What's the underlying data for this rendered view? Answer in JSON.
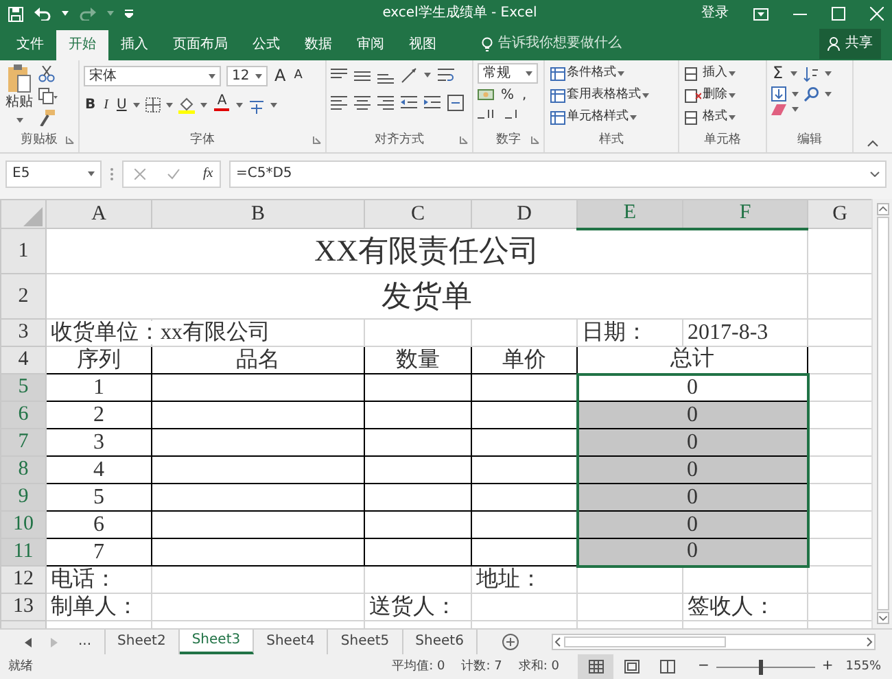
{
  "window": {
    "title": "excel学生成绩单 - Excel",
    "sign_in": "登录"
  },
  "ribbon_tabs": [
    {
      "label": "文件",
      "selected": false
    },
    {
      "label": "开始",
      "selected": true
    },
    {
      "label": "插入",
      "selected": false
    },
    {
      "label": "页面布局",
      "selected": false
    },
    {
      "label": "公式",
      "selected": false
    },
    {
      "label": "数据",
      "selected": false
    },
    {
      "label": "审阅",
      "selected": false
    },
    {
      "label": "视图",
      "selected": false
    }
  ],
  "tell_me": {
    "placeholder": "告诉我你想要做什么"
  },
  "share": "共享",
  "ribbon": {
    "clipboard": {
      "paste": "粘贴",
      "label": "剪贴板"
    },
    "font": {
      "name": "宋体",
      "size": "12",
      "grow": "A",
      "shrink": "A",
      "bold": "B",
      "italic": "I",
      "underline": "U",
      "font_color": "A",
      "label": "字体"
    },
    "alignment": {
      "label": "对齐方式"
    },
    "number": {
      "format": "常规",
      "percent": "%",
      "comma": ",",
      "label": "数字"
    },
    "styles": {
      "items": [
        "条件格式",
        "套用表格格式",
        "单元格样式"
      ],
      "label": "样式"
    },
    "cells": {
      "items": [
        "插入",
        "删除",
        "格式"
      ],
      "label": "单元格"
    },
    "editing": {
      "sum": "Σ",
      "label": "编辑"
    }
  },
  "formula_bar": {
    "name_box": "E5",
    "function_label": "fx",
    "formula": "=C5*D5"
  },
  "columns": [
    {
      "label": "A",
      "selected": false
    },
    {
      "label": "B",
      "selected": false
    },
    {
      "label": "C",
      "selected": false
    },
    {
      "label": "D",
      "selected": false
    },
    {
      "label": "E",
      "selected": true
    },
    {
      "label": "F",
      "selected": true
    },
    {
      "label": "G",
      "selected": false
    }
  ],
  "rows": [
    {
      "number": "1",
      "selected": false,
      "kind": "title",
      "text": "XX有限责任公司"
    },
    {
      "number": "2",
      "selected": false,
      "kind": "title",
      "text": "发货单"
    },
    {
      "number": "3",
      "selected": false,
      "kind": "info",
      "cells": [
        {
          "text": "收货单位：xx有限公司"
        },
        {},
        {},
        {},
        {
          "text": "日期："
        },
        {
          "text": "2017-8-3"
        },
        {}
      ]
    },
    {
      "number": "4",
      "selected": false,
      "kind": "table",
      "cells": [
        {
          "text": "序列",
          "selected": false
        },
        {
          "text": "品名",
          "selected": false
        },
        {
          "text": "数量",
          "selected": false
        },
        {
          "text": "单价",
          "selected": false
        },
        {
          "text": "总计",
          "selected": false
        }
      ]
    },
    {
      "number": "5",
      "selected": true,
      "kind": "table",
      "cells": [
        {
          "text": "1",
          "selected": false
        },
        {
          "selected": false
        },
        {
          "selected": false
        },
        {
          "selected": false
        },
        {
          "text": "0",
          "selected": true
        }
      ]
    },
    {
      "number": "6",
      "selected": true,
      "kind": "table",
      "cells": [
        {
          "text": "2",
          "selected": false
        },
        {
          "selected": false
        },
        {
          "selected": false
        },
        {
          "selected": false
        },
        {
          "text": "0",
          "selected": true
        }
      ]
    },
    {
      "number": "7",
      "selected": true,
      "kind": "table",
      "cells": [
        {
          "text": "3",
          "selected": false
        },
        {
          "selected": false
        },
        {
          "selected": false
        },
        {
          "selected": false
        },
        {
          "text": "0",
          "selected": true
        }
      ]
    },
    {
      "number": "8",
      "selected": true,
      "kind": "table",
      "cells": [
        {
          "text": "4",
          "selected": false
        },
        {
          "selected": false
        },
        {
          "selected": false
        },
        {
          "selected": false
        },
        {
          "text": "0",
          "selected": true
        }
      ]
    },
    {
      "number": "9",
      "selected": true,
      "kind": "table",
      "cells": [
        {
          "text": "5",
          "selected": false
        },
        {
          "selected": false
        },
        {
          "selected": false
        },
        {
          "selected": false
        },
        {
          "text": "0",
          "selected": true
        }
      ]
    },
    {
      "number": "10",
      "selected": true,
      "kind": "table",
      "cells": [
        {
          "text": "6",
          "selected": false
        },
        {
          "selected": false
        },
        {
          "selected": false
        },
        {
          "selected": false
        },
        {
          "text": "0",
          "selected": true
        }
      ]
    },
    {
      "number": "11",
      "selected": true,
      "kind": "table",
      "cells": [
        {
          "text": "7",
          "selected": false
        },
        {
          "selected": false
        },
        {
          "selected": false
        },
        {
          "selected": false
        },
        {
          "text": "0",
          "selected": true
        }
      ]
    },
    {
      "number": "12",
      "selected": false,
      "kind": "info",
      "cells": [
        {
          "text": "电话："
        },
        {},
        {},
        {
          "text": "地址："
        },
        {},
        {},
        {}
      ]
    },
    {
      "number": "13",
      "selected": false,
      "kind": "info",
      "cells": [
        {
          "text": "制单人："
        },
        {},
        {
          "text": "送货人："
        },
        {},
        {},
        {
          "text": "签收人："
        },
        {}
      ]
    }
  ],
  "sheet_tabs": {
    "more": "...",
    "tabs": [
      {
        "label": "Sheet2",
        "selected": false
      },
      {
        "label": "Sheet3",
        "selected": true
      },
      {
        "label": "Sheet4",
        "selected": false
      },
      {
        "label": "Sheet5",
        "selected": false
      },
      {
        "label": "Sheet6",
        "selected": false
      }
    ]
  },
  "status_bar": {
    "ready": "就绪",
    "average": "平均值: 0",
    "count": "计数: 7",
    "sum": "求和: 0",
    "views": [
      {
        "kind": "normal",
        "selected": true
      },
      {
        "kind": "page_layout",
        "selected": false
      },
      {
        "kind": "page_break",
        "selected": false
      }
    ],
    "zoom_out": "−",
    "zoom_in": "+",
    "zoom": {
      "level": 0.45,
      "reading": "155%"
    }
  }
}
